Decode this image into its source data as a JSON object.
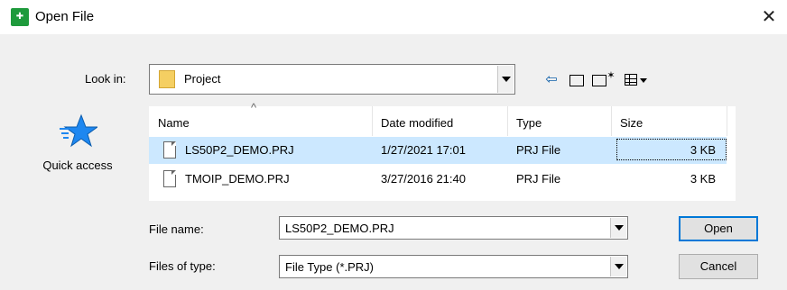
{
  "window": {
    "title": "Open File",
    "close_glyph": "✕",
    "app_icon": "app-logo-icon"
  },
  "lookin": {
    "label": "Look in:",
    "value": "Project"
  },
  "toolbar": {
    "back_glyph": "⇦",
    "new_folder_glyph": "✶",
    "icons": [
      "back-arrow-icon",
      "folder-up-icon",
      "new-folder-icon",
      "view-menu-icon"
    ]
  },
  "quick_access": {
    "label": "Quick access",
    "accent": "#1e87f0"
  },
  "filelist": {
    "sort_glyph": "^",
    "columns": [
      "Name",
      "Date modified",
      "Type",
      "Size"
    ],
    "rows": [
      {
        "name": "LS50P2_DEMO.PRJ",
        "date": "1/27/2021 17:01",
        "type": "PRJ File",
        "size": "3 KB",
        "selected": true
      },
      {
        "name": "TMOIP_DEMO.PRJ",
        "date": "3/27/2016 21:40",
        "type": "PRJ File",
        "size": "3 KB",
        "selected": false
      }
    ],
    "selection_color": "#cce8ff"
  },
  "file_name": {
    "label": "File name:",
    "value": "LS50P2_DEMO.PRJ"
  },
  "file_type": {
    "label": "Files of type:",
    "value": "File Type (*.PRJ)"
  },
  "buttons": {
    "open": "Open",
    "cancel": "Cancel"
  }
}
